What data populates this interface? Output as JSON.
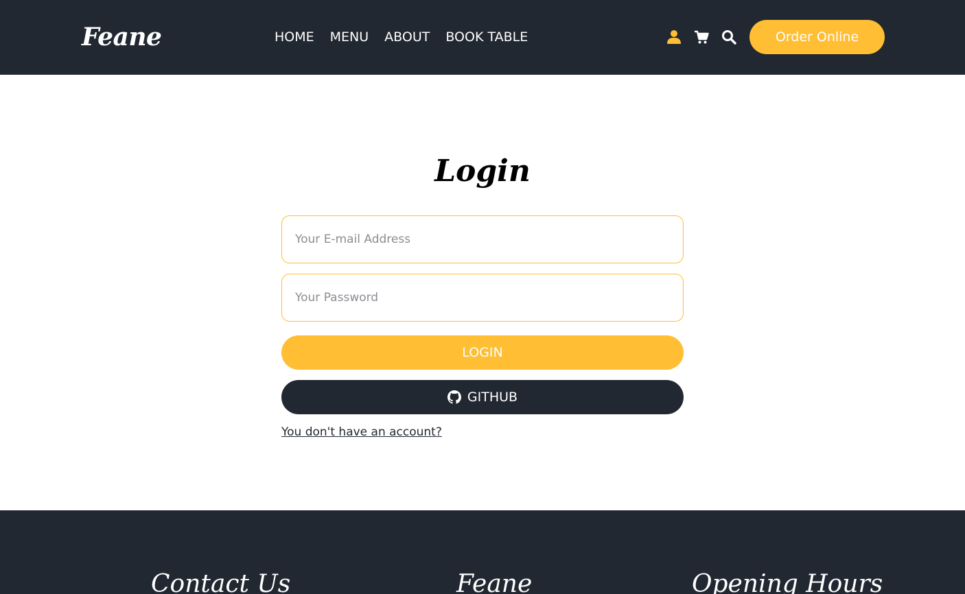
{
  "header": {
    "brand": "Feane",
    "nav": [
      {
        "label": "HOME"
      },
      {
        "label": "MENU"
      },
      {
        "label": "ABOUT"
      },
      {
        "label": "BOOK TABLE"
      }
    ],
    "icons": [
      "user-icon",
      "cart-icon",
      "search-icon"
    ],
    "order_label": "Order Online"
  },
  "login": {
    "title": "Login",
    "email_placeholder": "Your E-mail Address",
    "password_placeholder": "Your Password",
    "login_label": "LOGIN",
    "github_label": "GITHUB",
    "register_link": "You don't have an account?"
  },
  "footer": {
    "headings": [
      "Contact Us",
      "Feane",
      "Opening Hours"
    ]
  },
  "colors": {
    "accent": "#ffbe33",
    "dark": "#222831"
  }
}
